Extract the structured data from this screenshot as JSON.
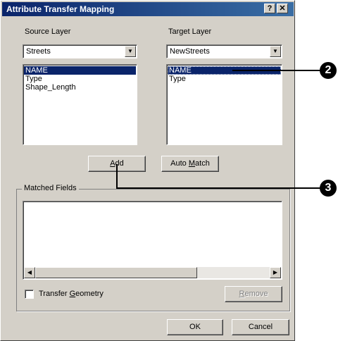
{
  "window": {
    "title": "Attribute Transfer Mapping",
    "help_button": "?",
    "close_button": "✕"
  },
  "source": {
    "label": "Source Layer",
    "selected": "Streets",
    "fields": [
      "NAME",
      "Type",
      "Shape_Length"
    ]
  },
  "target": {
    "label": "Target Layer",
    "selected": "NewStreets",
    "fields": [
      "NAME",
      "Type"
    ]
  },
  "buttons": {
    "add_pre": "",
    "add_hot": "A",
    "add_post": "dd",
    "auto_pre": "Auto ",
    "auto_hot": "M",
    "auto_post": "atch",
    "remove_pre": "",
    "remove_hot": "R",
    "remove_post": "emove",
    "ok": "OK",
    "cancel": "Cancel"
  },
  "matched": {
    "label": "Matched Fields",
    "items": []
  },
  "transfer_geometry": {
    "pre": "Transfer ",
    "hot": "G",
    "post": "eometry",
    "checked": false
  },
  "callouts": [
    "2",
    "3"
  ],
  "icons": {
    "dropdown": "▼",
    "scroll_left": "◀",
    "scroll_right": "▶"
  },
  "colors": {
    "dialog_bg": "#d4d0c8",
    "title_start": "#0a246a",
    "title_end": "#3a6ea5",
    "selection": "#0a246a"
  }
}
